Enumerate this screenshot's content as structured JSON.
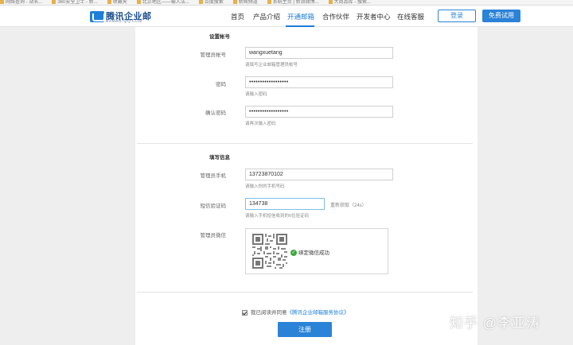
{
  "bookmarks": [
    "网络查询 - 站长...",
    "360安全卫士 - 新...",
    "收藏夹",
    "北京地区——输入法...",
    "百度搜索",
    "新闻频道",
    "系统主页 | 新浪微博...",
    "大商品库 - 搜索..."
  ],
  "header": {
    "logo_name": "腾讯企业邮",
    "logo_sub": "EXMAIL.QQ.COM",
    "nav": [
      "首页",
      "产品介绍",
      "开通邮箱",
      "合作伙伴",
      "开发者中心",
      "在线客服"
    ],
    "active_nav": "开通邮箱",
    "login_label": "登录",
    "trial_label": "免费试用"
  },
  "account_section": {
    "title": "设置帐号",
    "admin_account_label": "管理员帐号",
    "admin_account_value": "wangxuetang",
    "admin_account_hint": "请填写企业邮箱管理员帐号",
    "password_label": "密码",
    "password_value": "••••••••••••••••••",
    "password_hint": "请输入密码",
    "confirm_label": "确认密码",
    "confirm_value": "••••••••••••••••••",
    "confirm_hint": "请再次输入密码"
  },
  "info_section": {
    "title": "填写信息",
    "phone_label": "管理员手机",
    "phone_value": "13723870102",
    "phone_hint": "请输入你的手机号码",
    "code_label": "短信验证码",
    "code_value": "134738",
    "code_hint": "请输入手机短信收到的6位验证码",
    "resend_label": "重新获取（24s）",
    "wechat_label": "管理员微信",
    "wechat_status": "绑定微信成功"
  },
  "agreement": {
    "text": "我已阅读并同意",
    "link": "《腾讯企业邮箱服务协议》"
  },
  "register_label": "注册",
  "watermark": "知乎 @李亚涛",
  "colors": {
    "accent": "#2b83d8",
    "success": "#3cab3c"
  }
}
